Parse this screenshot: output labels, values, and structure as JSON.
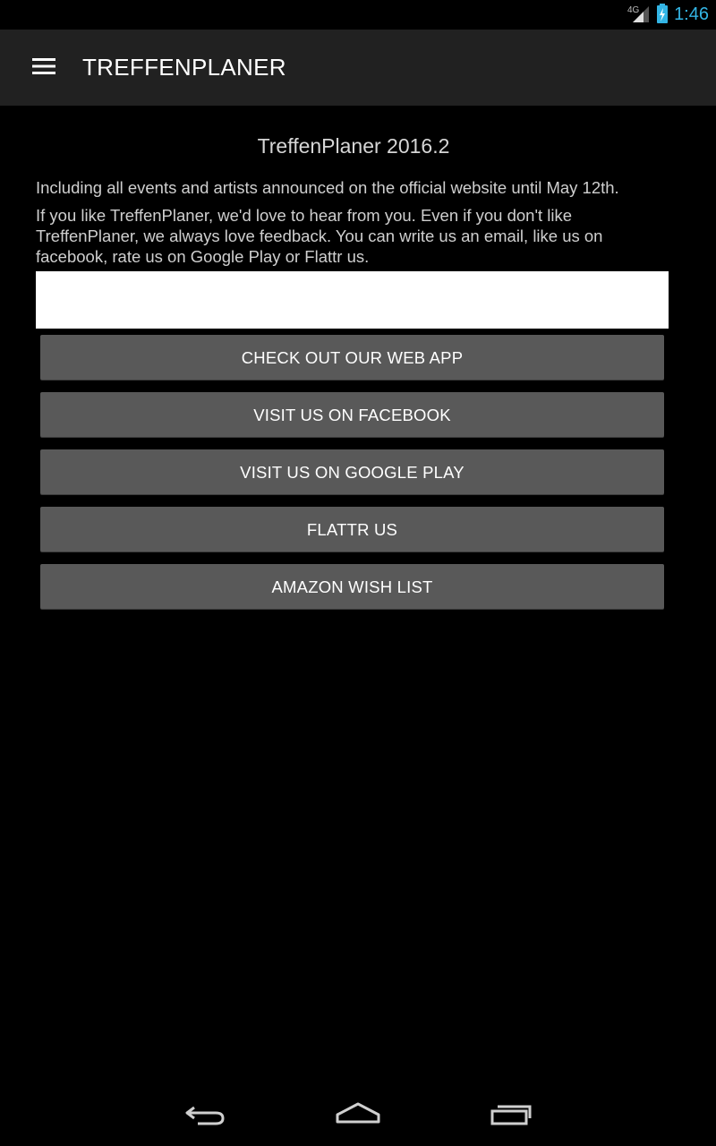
{
  "status_bar": {
    "network": "4G",
    "time": "1:46"
  },
  "app_bar": {
    "title": "TREFFENPLANER",
    "menu_icon": "hamburger-menu-icon"
  },
  "content": {
    "version_title": "TreffenPlaner 2016.2",
    "paragraph_1": "Including all events and artists announced on the official website until May 12th.",
    "paragraph_2": "If you like TreffenPlaner, we'd love to hear from you. Even if you don't like TreffenPlaner, we always love feedback. You can write us an email, like us on facebook, rate us on Google Play or Flattr us."
  },
  "buttons": {
    "web_app": "CHECK OUT OUR WEB APP",
    "facebook": "VISIT US ON FACEBOOK",
    "google_play": "VISIT US ON GOOGLE PLAY",
    "flattr": "FLATTR US",
    "amazon": "AMAZON WISH LIST"
  },
  "nav_bar": {
    "back_icon": "back-icon",
    "home_icon": "home-icon",
    "recents_icon": "recents-icon"
  },
  "colors": {
    "accent": "#33b5e5",
    "app_bar": "#212121",
    "button": "#595959",
    "background": "#000000"
  }
}
